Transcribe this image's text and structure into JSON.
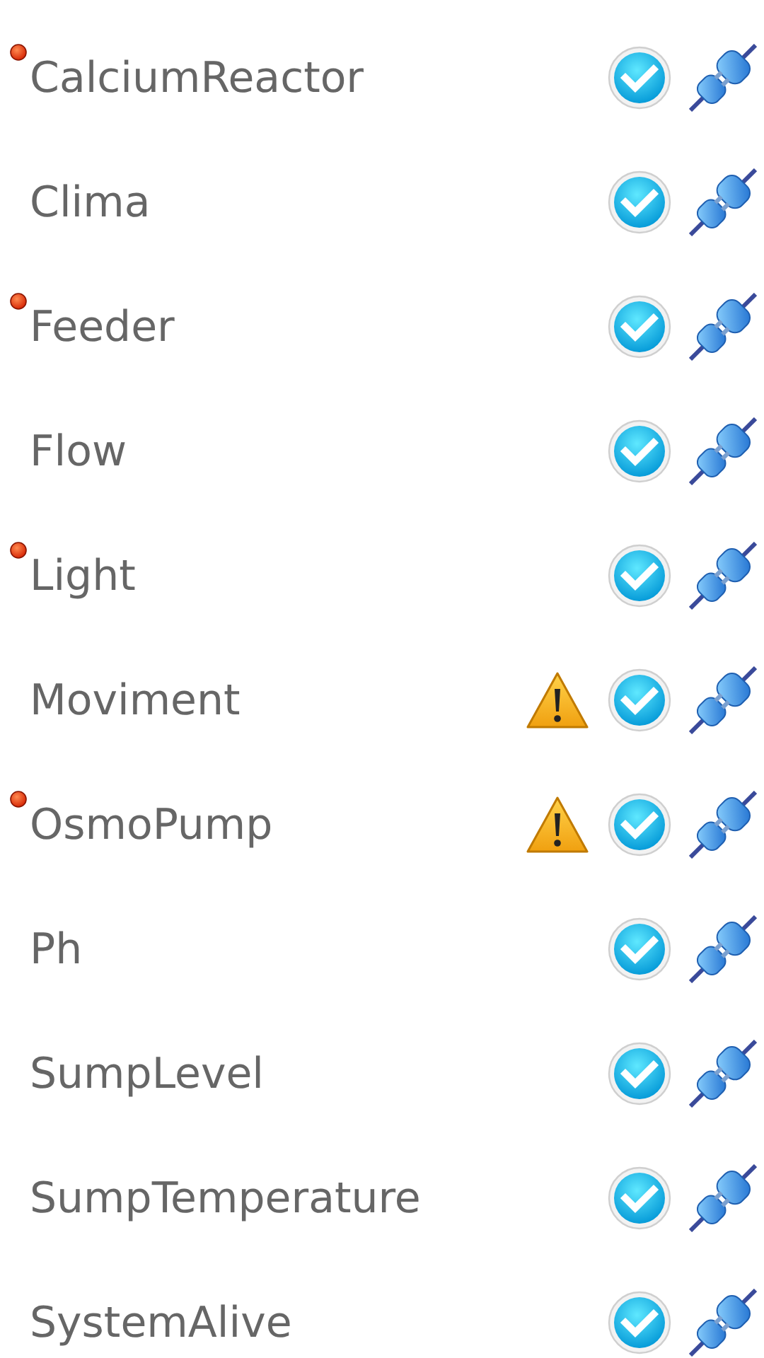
{
  "rows": [
    {
      "name": "CalciumReactor",
      "alert": true,
      "warning": false,
      "ok": true,
      "connected": true
    },
    {
      "name": "Clima",
      "alert": false,
      "warning": false,
      "ok": true,
      "connected": true
    },
    {
      "name": "Feeder",
      "alert": true,
      "warning": false,
      "ok": true,
      "connected": true
    },
    {
      "name": "Flow",
      "alert": false,
      "warning": false,
      "ok": true,
      "connected": true
    },
    {
      "name": "Light",
      "alert": true,
      "warning": false,
      "ok": true,
      "connected": true
    },
    {
      "name": "Moviment",
      "alert": false,
      "warning": true,
      "ok": true,
      "connected": true
    },
    {
      "name": "OsmoPump",
      "alert": true,
      "warning": true,
      "ok": true,
      "connected": true
    },
    {
      "name": "Ph",
      "alert": false,
      "warning": false,
      "ok": true,
      "connected": true
    },
    {
      "name": "SumpLevel",
      "alert": false,
      "warning": false,
      "ok": true,
      "connected": true
    },
    {
      "name": "SumpTemperature",
      "alert": false,
      "warning": false,
      "ok": true,
      "connected": true
    },
    {
      "name": "SystemAlive",
      "alert": false,
      "warning": false,
      "ok": true,
      "connected": true
    }
  ]
}
